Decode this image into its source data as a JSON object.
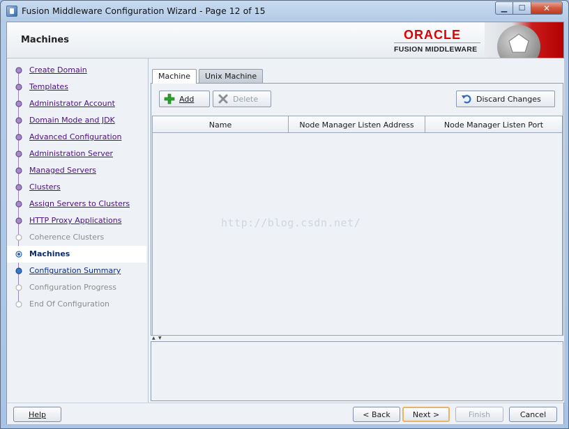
{
  "window": {
    "title": "Fusion Middleware Configuration Wizard - Page 12 of 15",
    "controls": {
      "minimize": "▁",
      "maximize": "☐",
      "close": "✕"
    }
  },
  "header": {
    "page_title": "Machines",
    "logo_top": "ORACLE",
    "logo_bottom": "FUSION MIDDLEWARE"
  },
  "nav": {
    "items": [
      {
        "label": "Create Domain",
        "state": "link"
      },
      {
        "label": "Templates",
        "state": "link"
      },
      {
        "label": "Administrator Account",
        "state": "link"
      },
      {
        "label": "Domain Mode and JDK",
        "state": "link"
      },
      {
        "label": "Advanced Configuration",
        "state": "link"
      },
      {
        "label": "Administration Server",
        "state": "link"
      },
      {
        "label": "Managed Servers",
        "state": "link"
      },
      {
        "label": "Clusters",
        "state": "link"
      },
      {
        "label": "Assign Servers to Clusters",
        "state": "link"
      },
      {
        "label": "HTTP Proxy Applications",
        "state": "link"
      },
      {
        "label": "Coherence Clusters",
        "state": "disabled"
      },
      {
        "label": "Machines",
        "state": "current"
      },
      {
        "label": "Configuration Summary",
        "state": "next"
      },
      {
        "label": "Configuration Progress",
        "state": "disabled"
      },
      {
        "label": "End Of Configuration",
        "state": "disabled"
      }
    ]
  },
  "tabs": [
    {
      "label": "Machine",
      "active": true
    },
    {
      "label": "Unix Machine",
      "active": false
    }
  ],
  "toolbar": {
    "add_label": "Add",
    "delete_label": "Delete",
    "discard_label": "Discard Changes"
  },
  "table": {
    "columns": [
      "Name",
      "Node Manager Listen Address",
      "Node Manager Listen Port"
    ],
    "rows": []
  },
  "watermark": "http://blog.csdn.net/",
  "footer": {
    "help": "Help",
    "back": "< Back",
    "next": "Next >",
    "finish": "Finish",
    "cancel": "Cancel"
  },
  "colors": {
    "nav_link": "#4b0f80",
    "current_step": "#0b2b6a",
    "oracle_red": "#e00000",
    "default_button_border": "#e8b562"
  }
}
